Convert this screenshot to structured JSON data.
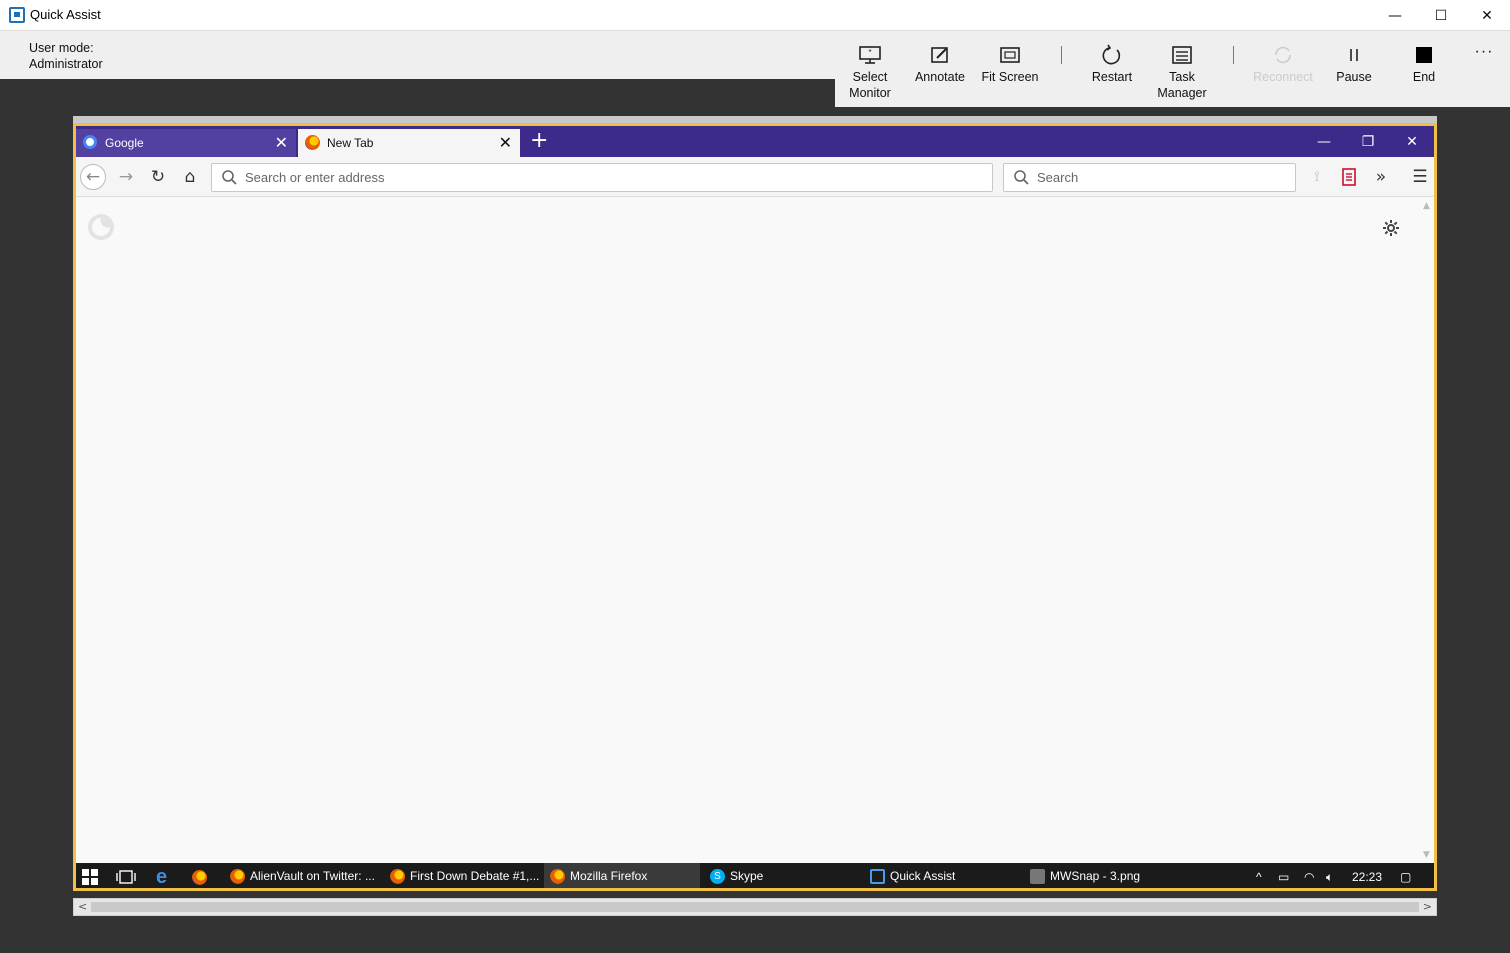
{
  "window": {
    "title": "Quick Assist",
    "user_mode_label": "User mode:",
    "user_mode_value": "Administrator"
  },
  "toolbar": {
    "select_monitor": "Select\nMonitor",
    "annotate": "Annotate",
    "fit_screen": "Fit Screen",
    "restart": "Restart",
    "task_manager": "Task\nManager",
    "reconnect": "Reconnect",
    "pause": "Pause",
    "end": "End",
    "more": "···"
  },
  "firefox": {
    "tabs": [
      {
        "label": "Google"
      },
      {
        "label": "New Tab"
      }
    ],
    "url_placeholder": "Search or enter address",
    "search_placeholder": "Search"
  },
  "taskbar": {
    "items": [
      {
        "label": "AlienVault on Twitter: ..."
      },
      {
        "label": "First Down Debate #1,..."
      },
      {
        "label": "Mozilla Firefox"
      },
      {
        "label": "Skype"
      },
      {
        "label": "Quick Assist"
      },
      {
        "label": "MWSnap - 3.png"
      }
    ],
    "clock": "22:23"
  },
  "colors": {
    "firefox_tabstrip": "#3d2a8a",
    "frame_accent": "#f0bf45"
  }
}
